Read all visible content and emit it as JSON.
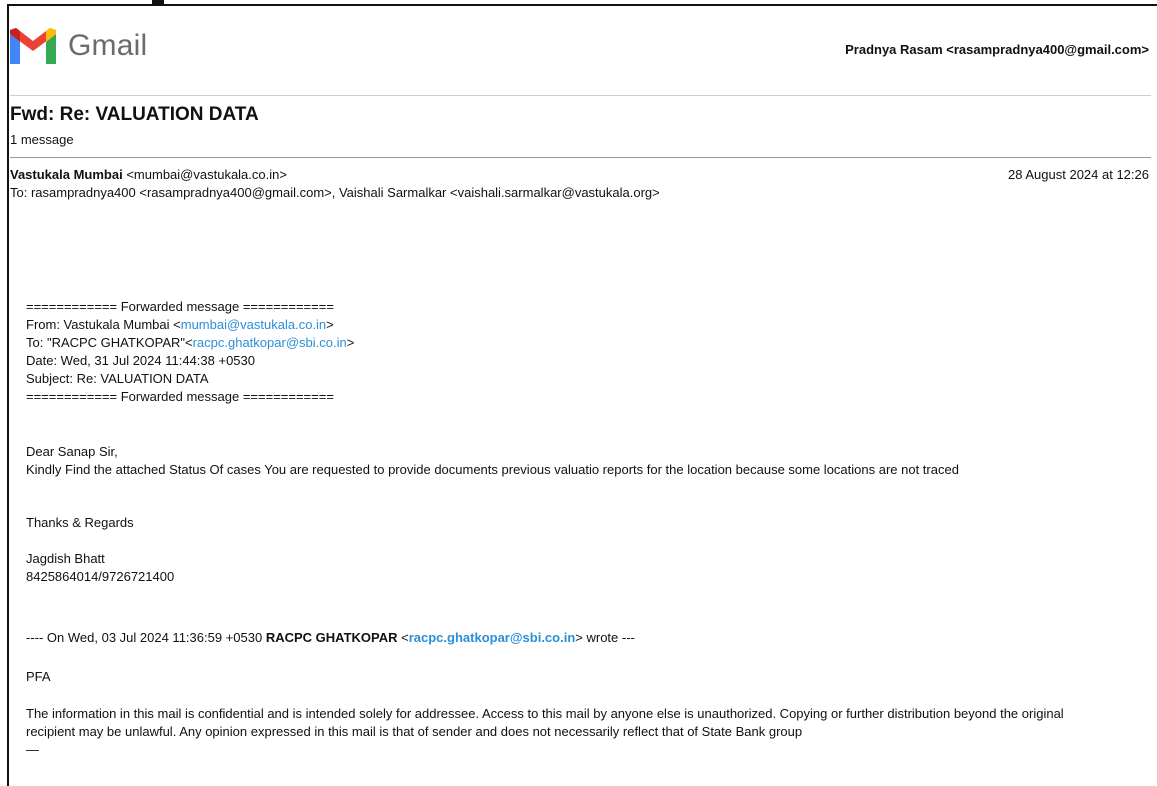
{
  "app": {
    "name": "Gmail"
  },
  "account": {
    "label": "Pradnya Rasam <rasampradnya400@gmail.com>"
  },
  "thread": {
    "subject": "Fwd: Re: VALUATION DATA",
    "count": "1 message"
  },
  "message": {
    "sender_name": "Vastukala Mumbai",
    "sender_email": "<mumbai@vastukala.co.in>",
    "date": "28 August 2024 at 12:26",
    "to_line": "To: rasampradnya400 <rasampradnya400@gmail.com>, Vaishali Sarmalkar <vaishali.sarmalkar@vastukala.org>"
  },
  "forwarded": {
    "separator": "============ Forwarded message ============",
    "from_prefix": "From: Vastukala Mumbai <",
    "from_link": "mumbai@vastukala.co.in",
    "from_suffix": ">",
    "to_prefix": "To: \"RACPC GHATKOPAR\"<",
    "to_link": "racpc.ghatkopar@sbi.co.in",
    "to_suffix": ">",
    "date": "Date: Wed, 31 Jul 2024 11:44:38 +0530",
    "subject": "Subject: Re: VALUATION DATA",
    "separator_end": "============ Forwarded message ============"
  },
  "content": {
    "greeting": "Dear Sanap Sir,",
    "body": "Kindly Find the attached Status Of cases You are requested to provide documents previous valuatio reports for the location because some locations are not traced",
    "closing": "Thanks & Regards",
    "signature_name": "Jagdish Bhatt",
    "signature_phone": "8425864014/9726721400"
  },
  "quote": {
    "prefix": "---- On Wed, 03 Jul 2024 11:36:59 +0530 ",
    "name": "RACPC GHATKOPAR",
    "link_open": " <",
    "link": "racpc.ghatkopar@sbi.co.in",
    "suffix": "> wrote ---",
    "pfa": "PFA",
    "disclaimer": "The information in this mail is confidential and is intended solely for addressee. Access to this mail by anyone else is unauthorized. Copying or further distribution beyond the original recipient may be unlawful. Any opinion expressed in this mail is that of sender and does not necessarily reflect that of State Bank group",
    "dash": "—"
  }
}
